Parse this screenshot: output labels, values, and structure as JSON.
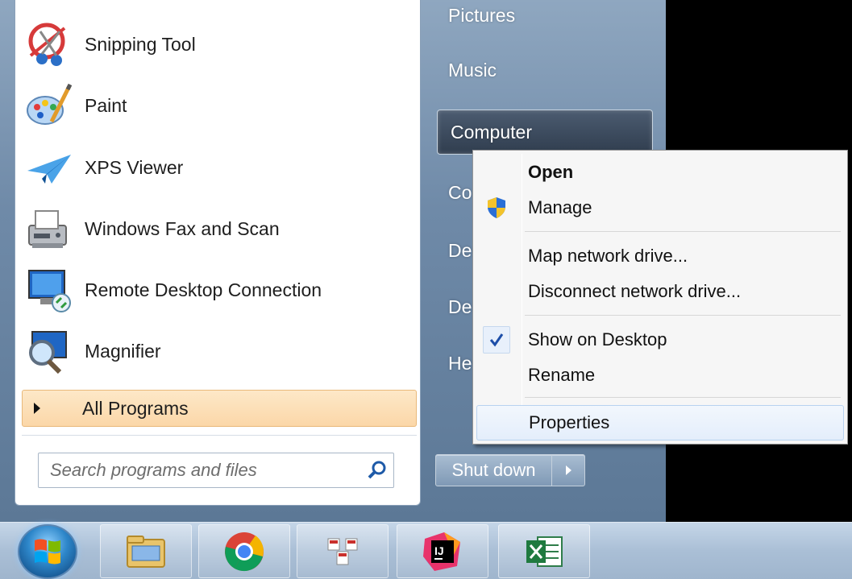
{
  "programs": [
    {
      "label": "Snipping Tool",
      "icon": "snipping-tool-icon"
    },
    {
      "label": "Paint",
      "icon": "paint-icon"
    },
    {
      "label": "XPS Viewer",
      "icon": "xps-viewer-icon"
    },
    {
      "label": "Windows Fax and Scan",
      "icon": "fax-scan-icon"
    },
    {
      "label": "Remote Desktop Connection",
      "icon": "remote-desktop-icon"
    },
    {
      "label": "Magnifier",
      "icon": "magnifier-icon"
    }
  ],
  "all_programs_label": "All Programs",
  "search": {
    "placeholder": "Search programs and files"
  },
  "right_items": {
    "pictures": "Pictures",
    "music": "Music",
    "computer": "Computer",
    "item4": "Co",
    "item5": "De",
    "item6": "De",
    "item7": "He"
  },
  "shutdown_label": "Shut down",
  "context_menu": {
    "open": "Open",
    "manage": "Manage",
    "map_drive": "Map network drive...",
    "disconnect_drive": "Disconnect network drive...",
    "show_desktop": "Show on Desktop",
    "rename": "Rename",
    "properties": "Properties"
  },
  "taskbar": {
    "items": [
      "file-explorer-icon",
      "chrome-icon",
      "app-icon",
      "intellij-icon",
      "excel-icon"
    ]
  },
  "colors": {
    "all_programs_highlight": "#fbd7a8",
    "start_menu_right": "#6f8aa8",
    "taskbar": "#aabfd6"
  }
}
